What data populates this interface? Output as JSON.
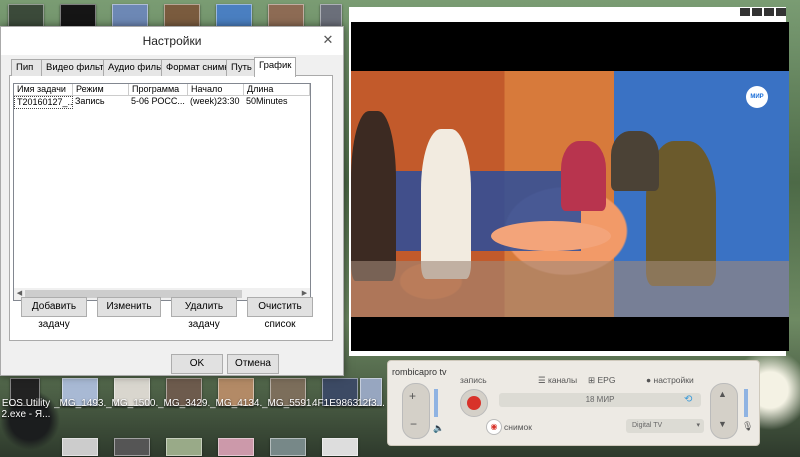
{
  "desktop": {
    "labels": [
      {
        "text": "EOS Utility\n2.exe - Я..."
      },
      {
        "text": "_MG_1493..."
      },
      {
        "text": "_MG_1500..."
      },
      {
        "text": "_MG_3429..."
      },
      {
        "text": "_MG_4134..."
      },
      {
        "text": "_MG_5591..."
      },
      {
        "text": "4F1E9863..."
      },
      {
        "text": "12f3..."
      }
    ]
  },
  "dialog": {
    "title": "Настройки",
    "tabs": [
      "Пип",
      "Видео фильтр",
      "Аудио фильтр",
      "Формат снимка",
      "Путь",
      "График"
    ],
    "active_tab": "График",
    "columns": [
      "Имя задачи",
      "Режим",
      "Программа",
      "Начало",
      "Длина"
    ],
    "rows": [
      [
        "T20160127_...",
        "Запись",
        "5-06 РОСС...",
        "(week)23:30",
        "50Minutes"
      ]
    ],
    "buttons": {
      "add": "Добавить задачу",
      "edit": "Изменить",
      "delete": "Удалить задачу",
      "clear": "Очистить список",
      "ok": "OK",
      "cancel": "Отмена"
    }
  },
  "video": {
    "channel_logo": "МИР"
  },
  "player": {
    "brand": "rombica",
    "brand_suffix": "pro tv",
    "record_label": "запись",
    "tabs": [
      "каналы",
      "EPG",
      "настройки"
    ],
    "channel": "18 МИР",
    "snapshot_label": "снимок",
    "input": "Digital TV"
  }
}
